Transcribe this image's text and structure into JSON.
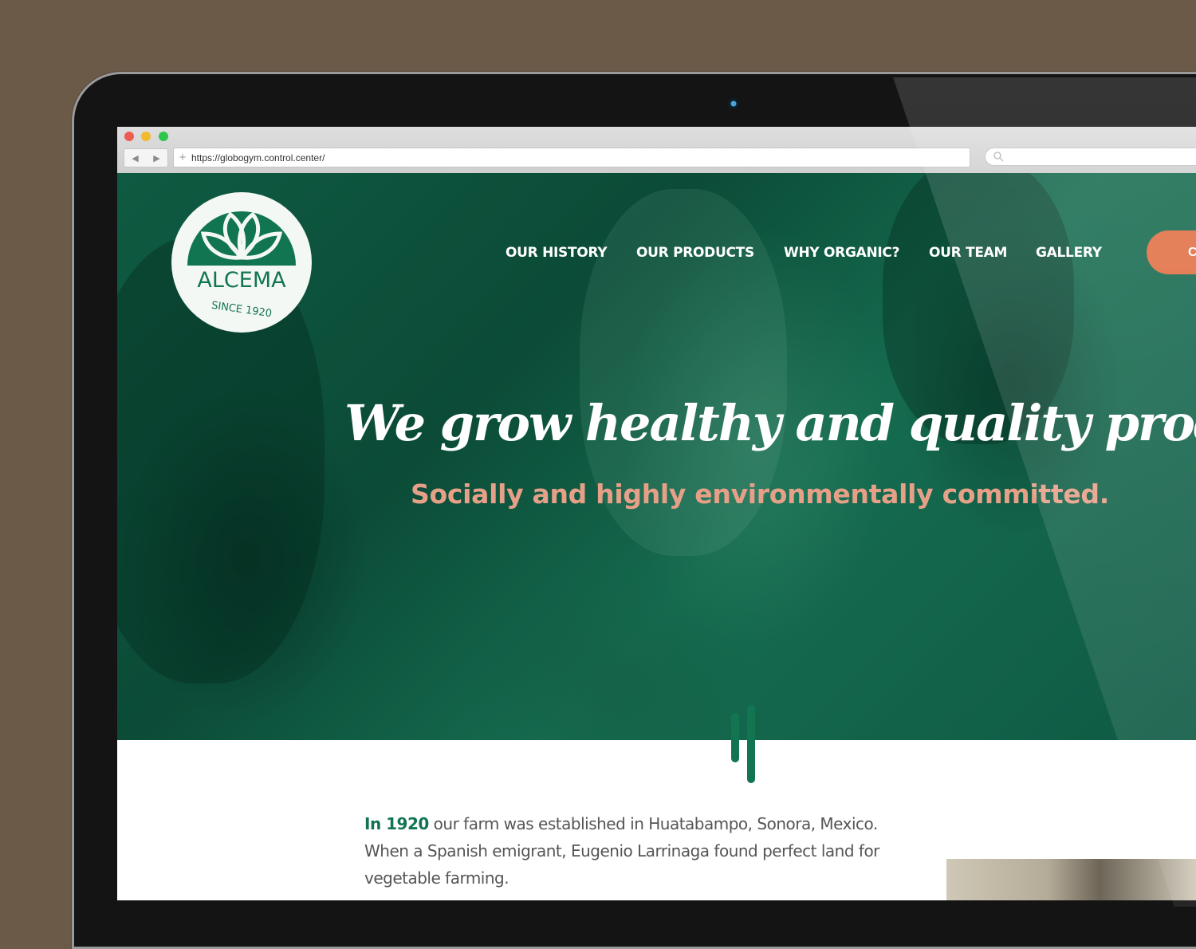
{
  "browser": {
    "url": "https://globogym.control.center/",
    "back_icon": "◀",
    "forward_icon": "▶",
    "new_tab_icon": "+",
    "search_icon": "search-icon"
  },
  "site": {
    "logo": {
      "name": "ALCEMA",
      "tagline": "SINCE 1920"
    },
    "nav": [
      "OUR HISTORY",
      "OUR PRODUCTS",
      "WHY ORGANIC?",
      "OUR TEAM",
      "GALLERY"
    ],
    "cta_label": "C",
    "hero": {
      "headline": "We grow healthy and quality products.",
      "subline": "Socially and highly environmentally committed."
    },
    "intro": {
      "year": "In 1920",
      "text": " our farm was established in Huatabampo, Sonora, Mexico. When a Spanish emigrant, Eugenio Larrinaga found perfect land for vegetable farming."
    }
  },
  "colors": {
    "brand_green": "#127552",
    "hero_green": "#0f5a42",
    "accent_orange": "#e06d42",
    "subline_peach": "#e7a088",
    "backdrop_brown": "#6b5a48"
  }
}
